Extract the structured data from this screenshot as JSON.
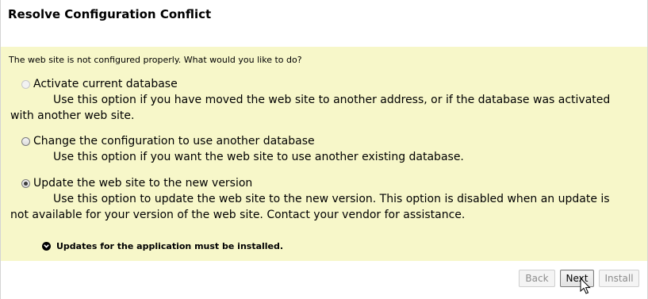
{
  "dialog": {
    "title": "Resolve Configuration Conflict",
    "prompt": "The web site is not configured properly. What would you like to do?",
    "options": [
      {
        "label": "Activate current database",
        "description": "Use this option if you have moved the web site to another address, or if the database was activated with another web site.",
        "state": "disabled"
      },
      {
        "label": "Change the configuration to use another database",
        "description": "Use this option if you want the web site to use another existing database.",
        "state": "enabled"
      },
      {
        "label": "Update the web site to the new version",
        "description": "Use this option to update the web site to the new version. This option is disabled when an update is not available for your version of the web site. Contact your vendor for assistance.",
        "state": "selected"
      }
    ],
    "notice": "Updates for the application must be installed.",
    "notice_icon": "chevron-down-circle-icon",
    "buttons": {
      "back": "Back",
      "next": "Next",
      "install": "Install"
    }
  }
}
